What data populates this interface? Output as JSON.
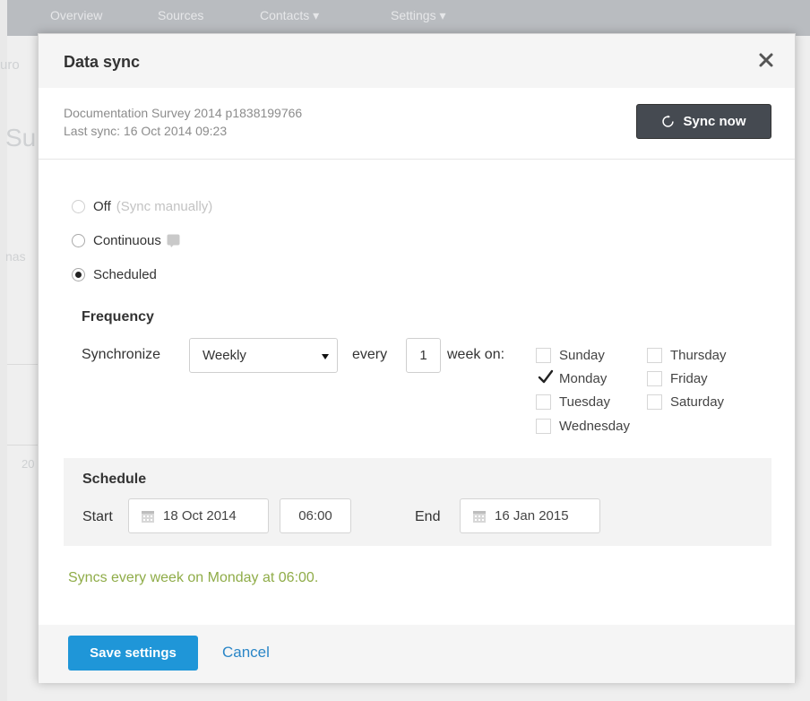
{
  "background": {
    "nav_items": [
      "Overview",
      "Sources",
      "Contacts ▾",
      "Settings ▾"
    ],
    "fragments": [
      "uro",
      "Su",
      "nas",
      "20"
    ]
  },
  "dialog": {
    "title": "Data sync",
    "close_icon": "close-icon"
  },
  "source": {
    "name": "Documentation Survey 2014 p1838199766",
    "last_sync": "Last sync: 16 Oct 2014 09:23",
    "sync_now_label": "Sync now",
    "sync_icon": "refresh-icon"
  },
  "sync_mode": {
    "selected": "Scheduled",
    "options": [
      {
        "label": "Off",
        "hint": "(Sync manually)",
        "checked": false,
        "disabled": true
      },
      {
        "label": "Continuous",
        "hint": "",
        "checked": false,
        "disabled": false
      },
      {
        "label": "Scheduled",
        "hint": "",
        "checked": true,
        "disabled": false
      }
    ]
  },
  "frequency": {
    "title": "Frequency",
    "synchronize_label": "Synchronize",
    "select_value": "Weekly",
    "every_label": "every",
    "interval": "1",
    "unit_label": "week on:",
    "days": [
      {
        "label": "Sunday",
        "checked": false
      },
      {
        "label": "Monday",
        "checked": true
      },
      {
        "label": "Tuesday",
        "checked": false
      },
      {
        "label": "Wednesday",
        "checked": false
      },
      {
        "label": "Thursday",
        "checked": false
      },
      {
        "label": "Friday",
        "checked": false
      },
      {
        "label": "Saturday",
        "checked": false
      }
    ]
  },
  "schedule": {
    "title": "Schedule",
    "start_label": "Start",
    "start_date": "18 Oct 2014",
    "start_time": "06:00",
    "end_label": "End",
    "end_date": "16 Jan 2015",
    "calendar_icon": "calendar-icon"
  },
  "summary": "Syncs every week on Monday at 06:00.",
  "footer": {
    "save_label": "Save settings",
    "cancel_label": "Cancel"
  },
  "colors": {
    "primary_button": "#1f96d8",
    "dark_button": "#454a51",
    "summary_text": "#8fac48",
    "link": "#2a86c7"
  }
}
